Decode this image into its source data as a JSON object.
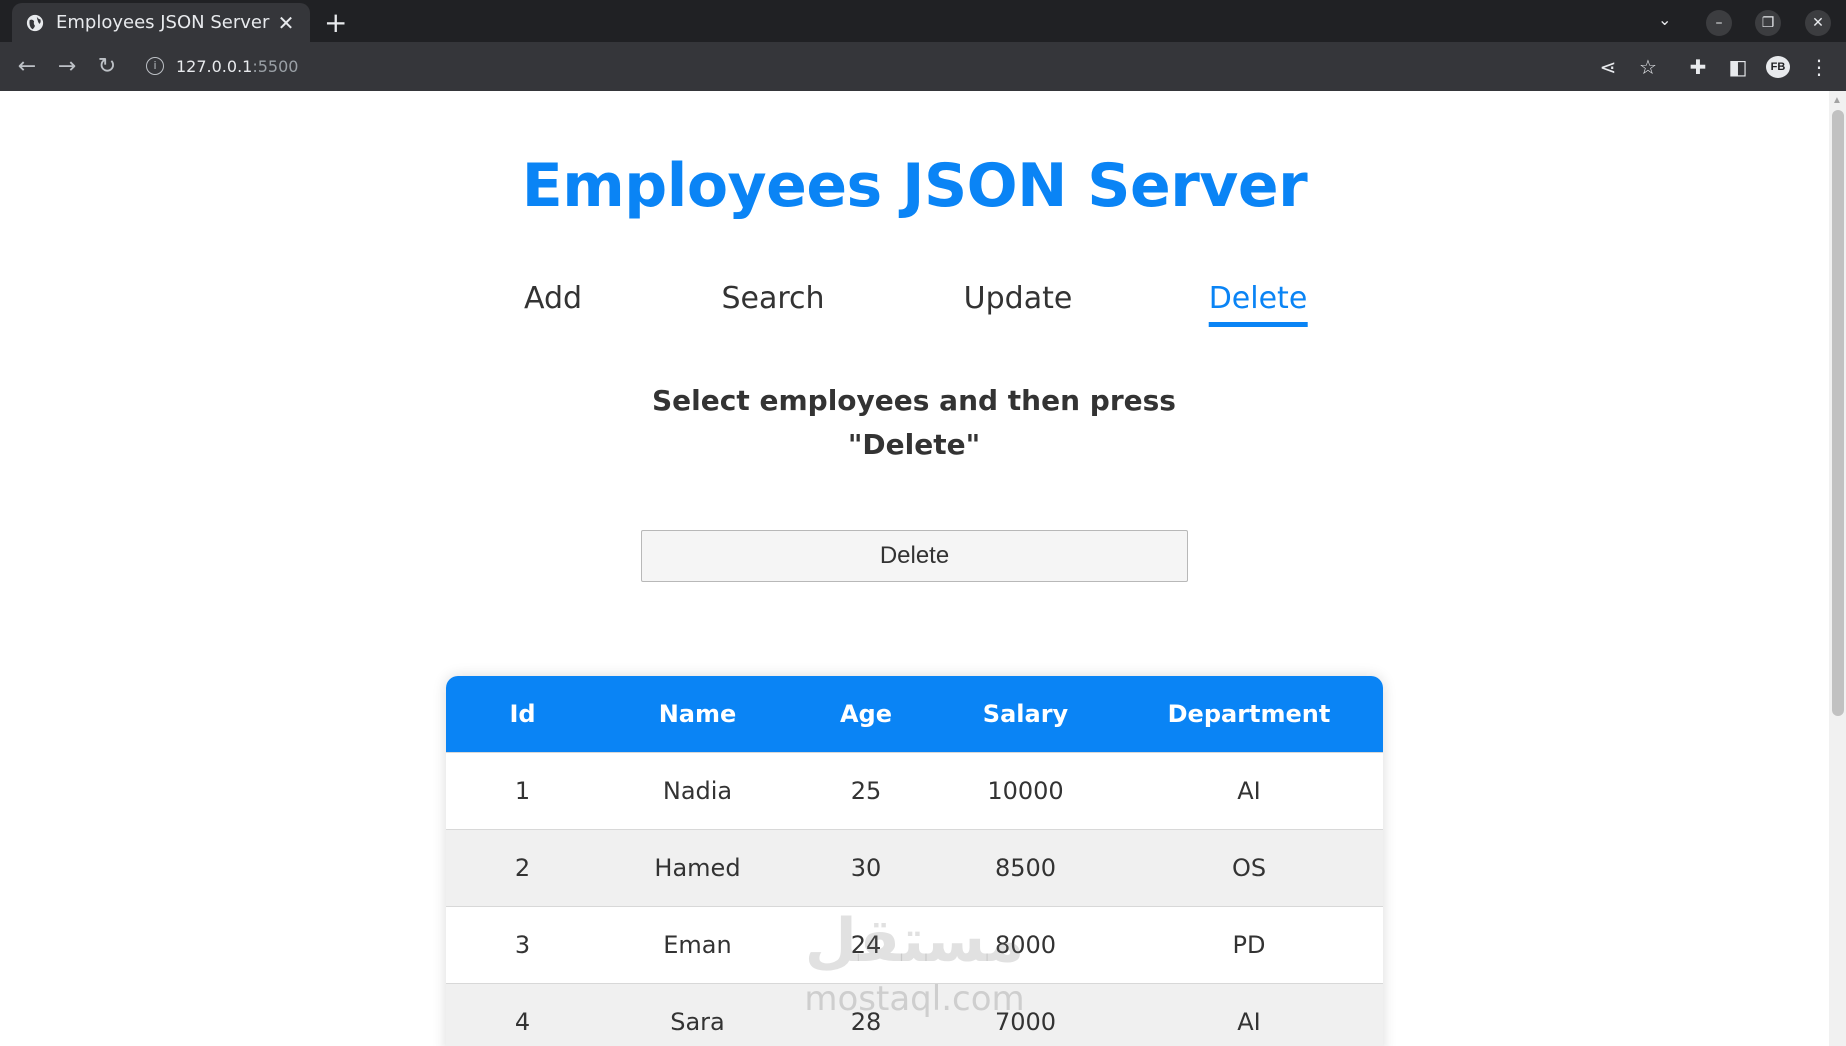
{
  "browser": {
    "tab_title": "Employees JSON Server",
    "tab_close": "✕",
    "new_tab": "+",
    "url_host": "127.0.0.1",
    "url_port": ":5500",
    "profile_initials": "FB"
  },
  "page": {
    "title": "Employees JSON Server",
    "nav": [
      {
        "label": "Add",
        "active": false
      },
      {
        "label": "Search",
        "active": false
      },
      {
        "label": "Update",
        "active": false
      },
      {
        "label": "Delete",
        "active": true
      }
    ],
    "instructions": "Select employees and then press \"Delete\"",
    "delete_button": "Delete",
    "accent_color": "#0a84f5"
  },
  "table": {
    "headers": [
      "Id",
      "Name",
      "Age",
      "Salary",
      "Department"
    ],
    "rows": [
      [
        "1",
        "Nadia",
        "25",
        "10000",
        "AI"
      ],
      [
        "2",
        "Hamed",
        "30",
        "8500",
        "OS"
      ],
      [
        "3",
        "Eman",
        "24",
        "8000",
        "PD"
      ],
      [
        "4",
        "Sara",
        "28",
        "7000",
        "AI"
      ]
    ]
  },
  "watermark": {
    "logo": "مستقل",
    "text": "mostaql.com"
  }
}
